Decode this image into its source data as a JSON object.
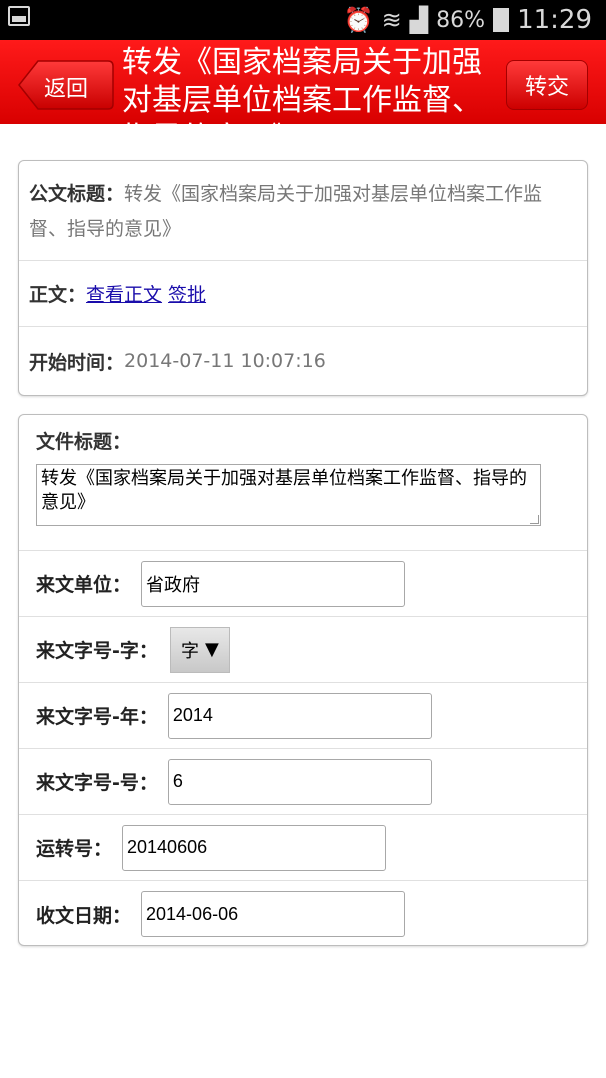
{
  "status_bar": {
    "battery": "86%",
    "time": "11:29"
  },
  "header": {
    "back_label": "返回",
    "title": "转发《国家档案局关于加强对基层单位档案工作监督、指导的意见》",
    "forward_label": "转交"
  },
  "doc_info": {
    "title_label": "公文标题：",
    "title_value": "转发《国家档案局关于加强对基层单位档案工作监督、指导的意见》",
    "body_label": "正文：",
    "view_body_link": "查看正文",
    "approve_link": "签批",
    "start_time_label": "开始时间：",
    "start_time_value": "2014-07-11 10:07:16"
  },
  "form": {
    "file_title_label": "文件标题：",
    "file_title_value": "转发《国家档案局关于加强对基层单位档案工作监督、指导的意见》",
    "source_unit_label": "来文单位：",
    "source_unit_value": "省政府",
    "doc_char_label": "来文字号-字：",
    "doc_char_value": "字",
    "doc_year_label": "来文字号-年：",
    "doc_year_value": "2014",
    "doc_num_label": "来文字号-号：",
    "doc_num_value": "6",
    "transfer_no_label": "运转号：",
    "transfer_no_value": "20140606",
    "receive_date_label": "收文日期：",
    "receive_date_value": "2014-06-06"
  }
}
